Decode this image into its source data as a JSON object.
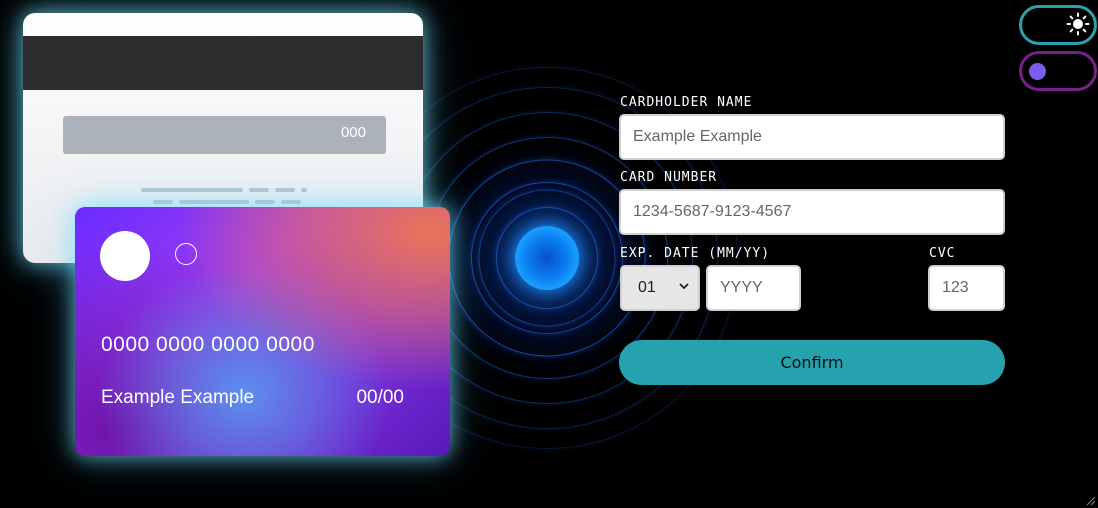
{
  "card_back": {
    "cvc": "000"
  },
  "card_front": {
    "number": "0000 0000 0000 0000",
    "name": "Example Example",
    "expiry": "00/00"
  },
  "form": {
    "cardholder_label": "CARDHOLDER NAME",
    "cardholder_placeholder": "Example Example",
    "card_number_label": "CARD NUMBER",
    "card_number_placeholder": "1234-5687-9123-4567",
    "exp_label": "EXP. DATE (MM/YY)",
    "exp_month_value": "01",
    "exp_year_placeholder": "YYYY",
    "cvc_label": "CVC",
    "cvc_placeholder": "123",
    "confirm_label": "Confirm"
  },
  "toggles": {
    "sun_icon": "sun-icon",
    "theme_knob_color": "#7b5cf0"
  },
  "colors": {
    "accent": "#26a2af",
    "radar": "#1e90ff"
  }
}
